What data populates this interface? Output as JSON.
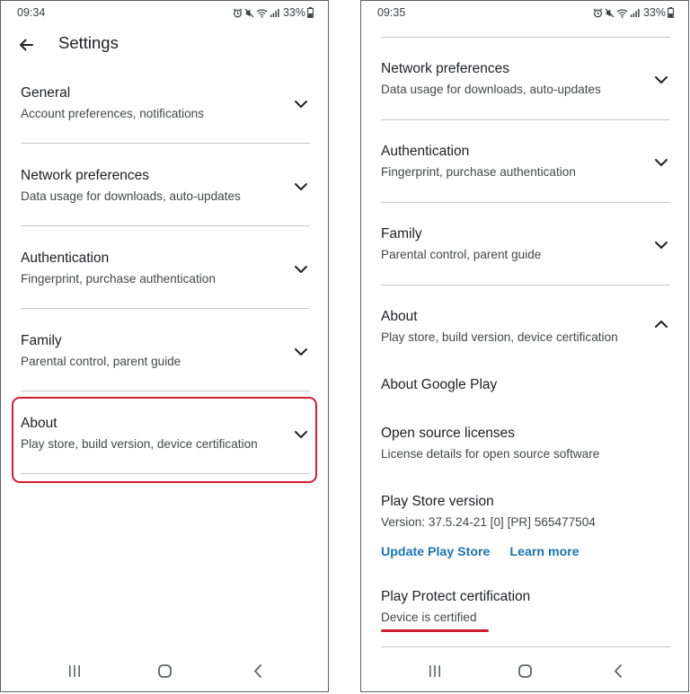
{
  "left": {
    "status_time": "09:34",
    "battery": "33%",
    "title": "Settings",
    "items": [
      {
        "title": "General",
        "subtitle": "Account preferences, notifications"
      },
      {
        "title": "Network preferences",
        "subtitle": "Data usage for downloads, auto-updates"
      },
      {
        "title": "Authentication",
        "subtitle": "Fingerprint, purchase authentication"
      },
      {
        "title": "Family",
        "subtitle": "Parental control, parent guide"
      },
      {
        "title": "About",
        "subtitle": "Play store, build version, device certification"
      }
    ]
  },
  "right": {
    "status_time": "09:35",
    "battery": "33%",
    "items": [
      {
        "title": "Network preferences",
        "subtitle": "Data usage for downloads, auto-updates"
      },
      {
        "title": "Authentication",
        "subtitle": "Fingerprint, purchase authentication"
      },
      {
        "title": "Family",
        "subtitle": "Parental control, parent guide"
      },
      {
        "title": "About",
        "subtitle": "Play store, build version, device certification"
      }
    ],
    "about_google_play": "About Google Play",
    "open_source": {
      "title": "Open source licenses",
      "subtitle": "License details for open source software"
    },
    "play_store_version": {
      "title": "Play Store version",
      "subtitle": "Version: 37.5.24-21 [0] [PR] 565477504"
    },
    "update_link": "Update Play Store",
    "learn_more_link": "Learn more",
    "play_protect": {
      "title": "Play Protect certification",
      "subtitle": "Device is certified"
    }
  },
  "colors": {
    "highlight": "#d0202f",
    "link": "#1a73b8",
    "divider": "#c4c7c5"
  },
  "icons": [
    "back-arrow-icon",
    "chevron-down-icon",
    "chevron-up-icon",
    "alarm-icon",
    "mute-icon",
    "wifi-icon",
    "signal-icon",
    "battery-icon",
    "recents-icon",
    "home-icon",
    "nav-back-icon"
  ]
}
